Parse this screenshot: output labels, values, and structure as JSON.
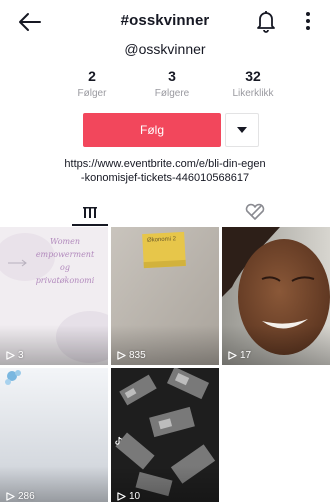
{
  "header": {
    "title": "#osskvinner",
    "back_icon": "back-arrow-icon",
    "bell_icon": "bell-icon",
    "more_icon": "more-vertical-icon"
  },
  "profile": {
    "handle": "@osskvinner",
    "stats": [
      {
        "value": "2",
        "label": "Følger"
      },
      {
        "value": "3",
        "label": "Følgere"
      },
      {
        "value": "32",
        "label": "Likerklikk"
      }
    ],
    "follow_label": "Følg",
    "bio_line1": "https://www.eventbrite.com/e/bli-din-egen",
    "bio_line2": "-konomisjef-tickets-446010568617"
  },
  "tabs": {
    "videos_icon": "grid-icon",
    "liked_icon": "liked-heart-icon"
  },
  "videos": [
    {
      "views": "3",
      "overlay_lines": [
        "Women",
        "empowerment",
        "og",
        "privatøkonomi"
      ]
    },
    {
      "views": "835",
      "note_text": "Økonomi 2"
    },
    {
      "views": "17"
    },
    {
      "views": "286"
    },
    {
      "views": "10"
    }
  ],
  "colors": {
    "accent": "#f2475c",
    "text": "#161823",
    "muted": "#9a9aa0",
    "border": "#e3e3e4"
  }
}
